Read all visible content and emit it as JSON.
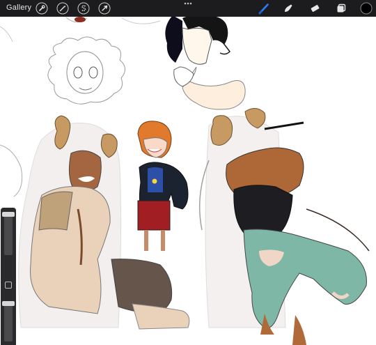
{
  "toolbar": {
    "gallery_label": "Gallery",
    "left_tools": [
      {
        "name": "actions",
        "icon": "wrench-icon"
      },
      {
        "name": "adjustments",
        "icon": "magic-wand-icon"
      },
      {
        "name": "selection",
        "icon": "selection-s-icon"
      },
      {
        "name": "transform",
        "icon": "arrow-cursor-icon"
      }
    ],
    "more_icon": "ellipsis-icon",
    "right_tools": [
      {
        "name": "brush",
        "icon": "brush-icon",
        "active": true
      },
      {
        "name": "smudge",
        "icon": "smudge-icon"
      },
      {
        "name": "eraser",
        "icon": "eraser-icon"
      },
      {
        "name": "layers",
        "icon": "layers-icon"
      },
      {
        "name": "color",
        "icon": "color-swatch-icon",
        "value": "#000000"
      }
    ],
    "accent": "#2f7cf6"
  },
  "sidebar": {
    "brush_size_level": 0.95,
    "opacity_level": 0.95,
    "modify_icon": "square-modify-icon"
  },
  "canvas": {
    "content": "sketch-sheet-with-character-drawings"
  }
}
